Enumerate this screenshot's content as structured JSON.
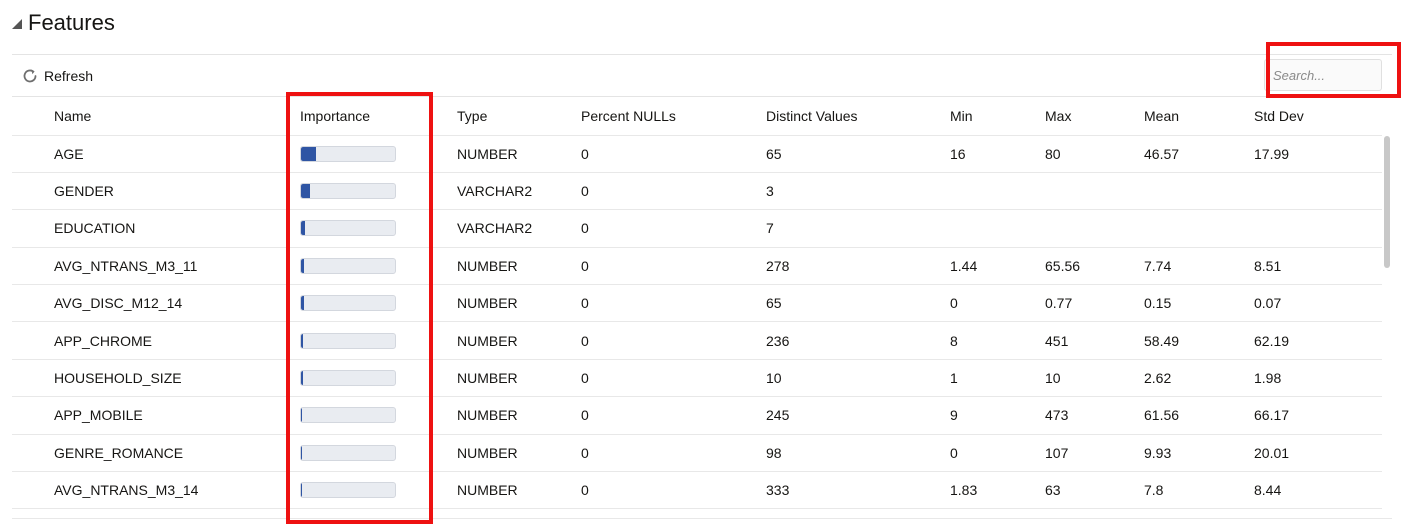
{
  "section": {
    "title": "Features"
  },
  "toolbar": {
    "refresh_label": "Refresh"
  },
  "search": {
    "placeholder": "Search...",
    "value": ""
  },
  "table": {
    "columns": [
      "Name",
      "Importance",
      "Type",
      "Percent NULLs",
      "Distinct Values",
      "Min",
      "Max",
      "Mean",
      "Std Dev"
    ],
    "rows": [
      {
        "name": "AGE",
        "importance": 0.16,
        "type": "NUMBER",
        "percent_nulls": "0",
        "distinct": "65",
        "min": "16",
        "max": "80",
        "mean": "46.57",
        "std": "17.99"
      },
      {
        "name": "GENDER",
        "importance": 0.1,
        "type": "VARCHAR2",
        "percent_nulls": "0",
        "distinct": "3",
        "min": "",
        "max": "",
        "mean": "",
        "std": ""
      },
      {
        "name": "EDUCATION",
        "importance": 0.04,
        "type": "VARCHAR2",
        "percent_nulls": "0",
        "distinct": "7",
        "min": "",
        "max": "",
        "mean": "",
        "std": ""
      },
      {
        "name": "AVG_NTRANS_M3_11",
        "importance": 0.03,
        "type": "NUMBER",
        "percent_nulls": "0",
        "distinct": "278",
        "min": "1.44",
        "max": "65.56",
        "mean": "7.74",
        "std": "8.51"
      },
      {
        "name": "AVG_DISC_M12_14",
        "importance": 0.03,
        "type": "NUMBER",
        "percent_nulls": "0",
        "distinct": "65",
        "min": "0",
        "max": "0.77",
        "mean": "0.15",
        "std": "0.07"
      },
      {
        "name": "APP_CHROME",
        "importance": 0.02,
        "type": "NUMBER",
        "percent_nulls": "0",
        "distinct": "236",
        "min": "8",
        "max": "451",
        "mean": "58.49",
        "std": "62.19"
      },
      {
        "name": "HOUSEHOLD_SIZE",
        "importance": 0.02,
        "type": "NUMBER",
        "percent_nulls": "0",
        "distinct": "10",
        "min": "1",
        "max": "10",
        "mean": "2.62",
        "std": "1.98"
      },
      {
        "name": "APP_MOBILE",
        "importance": 0.015,
        "type": "NUMBER",
        "percent_nulls": "0",
        "distinct": "245",
        "min": "9",
        "max": "473",
        "mean": "61.56",
        "std": "66.17"
      },
      {
        "name": "GENRE_ROMANCE",
        "importance": 0.015,
        "type": "NUMBER",
        "percent_nulls": "0",
        "distinct": "98",
        "min": "0",
        "max": "107",
        "mean": "9.93",
        "std": "20.01"
      },
      {
        "name": "AVG_NTRANS_M3_14",
        "importance": 0.015,
        "type": "NUMBER",
        "percent_nulls": "0",
        "distinct": "333",
        "min": "1.83",
        "max": "63",
        "mean": "7.8",
        "std": "8.44"
      }
    ]
  },
  "icons": {
    "collapse": "triangle-collapse-icon",
    "refresh": "refresh-icon"
  },
  "colors": {
    "importance_fill": "#2f55a4",
    "highlight": "#ee1111"
  }
}
